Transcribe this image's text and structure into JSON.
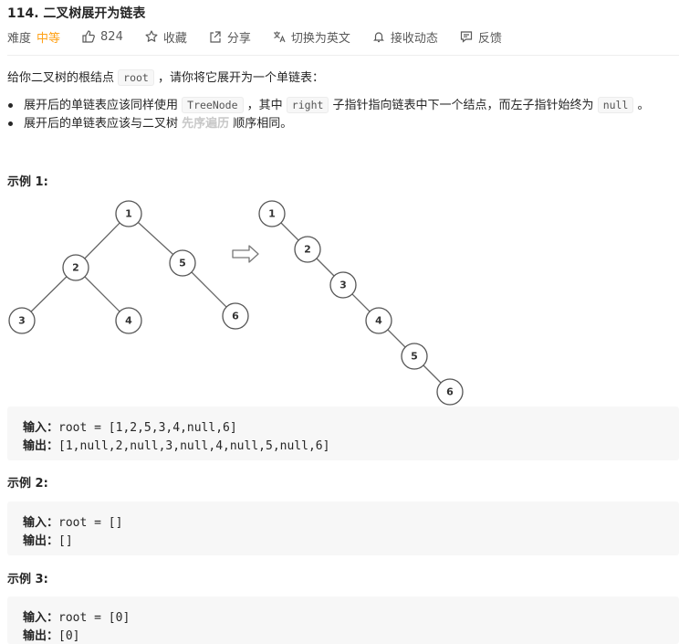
{
  "problem": {
    "title": "114. 二叉树展开为链表"
  },
  "meta": {
    "difficulty_label": "难度",
    "difficulty_value": "中等",
    "likes": "824",
    "collect": "收藏",
    "share": "分享",
    "switch_lang": "切换为英文",
    "notify": "接收动态",
    "feedback": "反馈",
    "colors": {
      "difficulty": "#ffa116"
    },
    "icons": [
      "thumbs-up-icon",
      "star-icon",
      "share-icon",
      "translate-icon",
      "bell-icon",
      "feedback-icon"
    ]
  },
  "description": {
    "intro_pre": "给你二叉树的根结点 ",
    "intro_code": "root",
    "intro_post": " ，请你将它展开为一个单链表：",
    "bullet1_pre": "展开后的单链表应该同样使用 ",
    "bullet1_code1": "TreeNode",
    "bullet1_mid1": " ，其中 ",
    "bullet1_code2": "right",
    "bullet1_mid2": " 子指针指向链表中下一个结点，而左子指针始终为 ",
    "bullet1_code3": "null",
    "bullet1_post": " 。",
    "bullet2_pre": "展开后的单链表应该与二叉树 ",
    "bullet2_faint": "先序遍历",
    "bullet2_post": " 顺序相同。"
  },
  "examples": [
    {
      "title": "示例 1:",
      "input_label": "输入：",
      "input": "root = [1,2,5,3,4,null,6]",
      "output_label": "输出：",
      "output": "[1,null,2,null,3,null,4,null,5,null,6]"
    },
    {
      "title": "示例 2:",
      "input_label": "输入：",
      "input": "root = []",
      "output_label": "输出：",
      "output": "[]"
    },
    {
      "title": "示例 3:",
      "input_label": "输入：",
      "input": "root = [0]",
      "output_label": "输出：",
      "output": "[0]"
    }
  ],
  "figure": {
    "tree_nodes": [
      "1",
      "2",
      "5",
      "3",
      "4",
      "6"
    ],
    "list_nodes": [
      "1",
      "2",
      "3",
      "4",
      "5",
      "6"
    ]
  }
}
